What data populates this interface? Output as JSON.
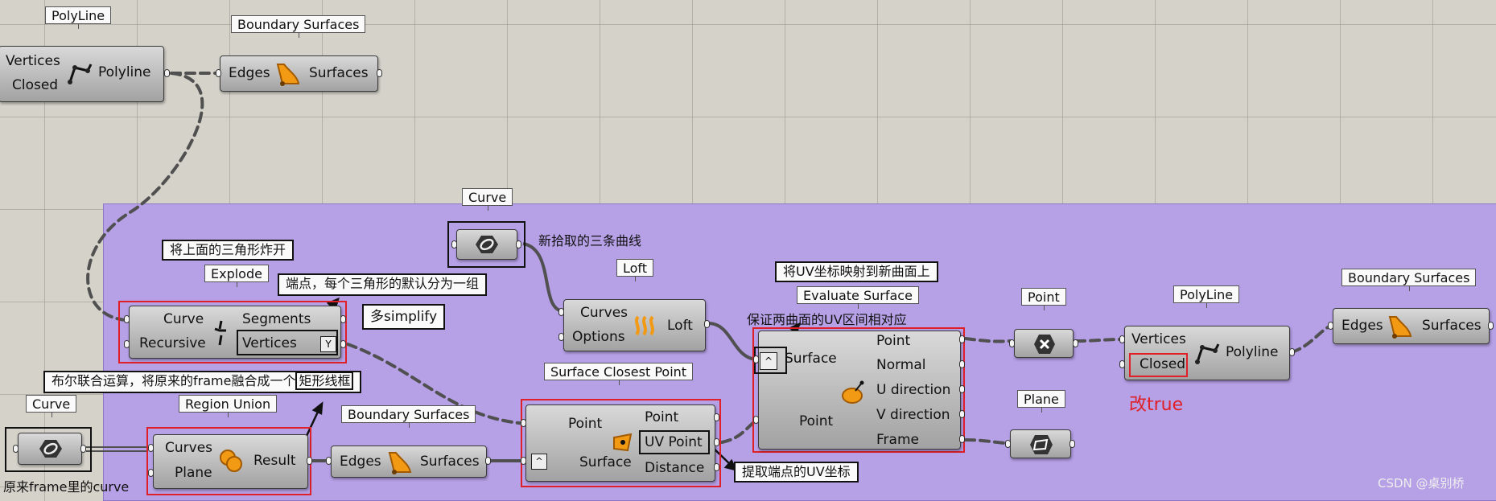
{
  "tags": {
    "polyline_top": "PolyLine",
    "boundary_top": "Boundary Surfaces",
    "curve_mid": "Curve",
    "explode": "Explode",
    "loft": "Loft",
    "evaluate_surface": "Evaluate Surface",
    "point": "Point",
    "polyline_right": "PolyLine",
    "boundary_right": "Boundary Surfaces",
    "curve_left": "Curve",
    "region_union": "Region Union",
    "boundary_bottom": "Boundary Surfaces",
    "surface_closest_point": "Surface Closest Point",
    "plane": "Plane"
  },
  "components": {
    "polyline_top": {
      "in": [
        "Vertices",
        "Closed"
      ],
      "out": [
        "Polyline"
      ]
    },
    "boundary_top": {
      "in": [
        "Edges"
      ],
      "out": [
        "Surfaces"
      ]
    },
    "explode": {
      "in": [
        "Curve",
        "Recursive"
      ],
      "out": [
        "Segments",
        "Vertices"
      ]
    },
    "loft": {
      "in": [
        "Curves",
        "Options"
      ],
      "out": [
        "Loft"
      ]
    },
    "evaluate_surface": {
      "in": [
        "Surface",
        "Point"
      ],
      "out": [
        "Point",
        "Normal",
        "U direction",
        "V direction",
        "Frame"
      ]
    },
    "polyline_right": {
      "in": [
        "Vertices",
        "Closed"
      ],
      "out": [
        "Polyline"
      ]
    },
    "boundary_right": {
      "in": [
        "Edges"
      ],
      "out": [
        "Surfaces"
      ]
    },
    "region_union": {
      "in": [
        "Curves",
        "Plane"
      ],
      "out": [
        "Result"
      ]
    },
    "boundary_bottom": {
      "in": [
        "Edges"
      ],
      "out": [
        "Surfaces"
      ]
    },
    "surface_closest_point": {
      "in": [
        "Point",
        "Surface"
      ],
      "out": [
        "Point",
        "UV Point",
        "Distance"
      ]
    }
  },
  "annotations": {
    "new_curves": "新拾取的三条曲线",
    "explode_triangle": "将上面的三角形炸开",
    "endpoints_group": "端点，每个三角形的默认分为一组",
    "simplify": "多simplify",
    "map_uv": "将UV坐标映射到新曲面上",
    "uv_match": "保证两曲面的UV区间相对应",
    "boolean_union": "布尔联合运算，将原来的frame融合成一个",
    "rect_frame": "矩形线框",
    "original_curve": "原来frame里的curve",
    "extract_uv": "提取端点的UV坐标",
    "set_true": "改true"
  },
  "watermark": "CSDN @桌别桥",
  "colors": {
    "canvas": "#d5d2ca",
    "group": "#b6a0e6",
    "highlight_red": "#e02028",
    "wire": "#505050"
  }
}
